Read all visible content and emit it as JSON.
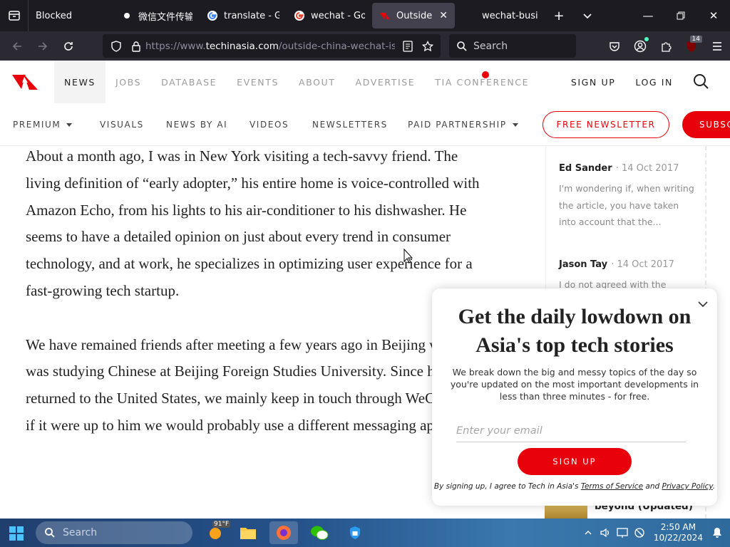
{
  "browser": {
    "tabs": [
      {
        "title": "Blocked",
        "icon": "tab-menu-icon",
        "active": false
      },
      {
        "title": "微信文件传输助手",
        "icon": "wechat-file-icon",
        "active": false
      },
      {
        "title": "translate - Goo",
        "icon": "google-icon",
        "active": false
      },
      {
        "title": "wechat - Goog",
        "icon": "google-icon",
        "active": false
      },
      {
        "title": "Outside of C",
        "icon": "techinasia-icon",
        "active": true
      },
      {
        "title": "wechat-busine",
        "icon": "generic-page-icon",
        "active": false
      }
    ],
    "url_prefix": "https://www.",
    "url_domain": "techinasia.com",
    "url_path": "/outside-china-wechat-is-a-fis",
    "search_placeholder": "Search",
    "extension_badge": "14"
  },
  "site": {
    "brand_color": "#e8000b",
    "nav": [
      "NEWS",
      "JOBS",
      "DATABASE",
      "EVENTS",
      "ABOUT",
      "ADVERTISE",
      "TIA CONFERENCE"
    ],
    "active_nav": "NEWS",
    "sign_up": "SIGN UP",
    "log_in": "LOG IN",
    "subnav": [
      "PREMIUM",
      "VISUALS",
      "NEWS BY AI",
      "VIDEOS",
      "NEWSLETTERS",
      "PAID PARTNERSHIP"
    ],
    "free_newsletter": "FREE NEWSLETTER",
    "subscribe": "SUBSC"
  },
  "article": {
    "paragraphs": [
      "About a month ago, I was in New York visiting a tech-savvy friend. The living definition of “early adopter,” his entire home is voice-controlled with Amazon Echo, from his lights to his air-conditioner to his dishwasher. He seems to have a detailed opinion on just about every trend in consumer technology, and at work, he specializes in optimizing user experience for a fast-growing tech startup.",
      "We have remained friends after meeting a few years ago in Beijing when he was studying Chinese at Beijing Foreign Studies University. Since he returned to the United States, we mainly keep in touch through WeChat, but if it were up to him we would probably use a different messaging app."
    ]
  },
  "comments": [
    {
      "author": "Ed Sander",
      "date": "14 Oct 2017",
      "text": "I'm wondering if, when writing the article, you have taken into account that the..."
    },
    {
      "author": "Jason Tay",
      "date": "14 Oct 2017",
      "text": "I do not agreed with the writer."
    }
  ],
  "popup": {
    "title": "Get the daily lowdown on Asia's top tech stories",
    "description": "We break down the big and messy topics of the day so you're updated on the most important developments in less than three minutes - for free.",
    "email_placeholder": "Enter your email",
    "button": "SIGN UP",
    "legal_prefix": "By signing up, I agree to Tech in Asia's ",
    "terms": "Terms of Service",
    "legal_and": " and ",
    "privacy": "Privacy Policy",
    "legal_suffix": "."
  },
  "related": {
    "title": "beyond (Updated)"
  },
  "taskbar": {
    "search_placeholder": "Search",
    "weather": "91°F",
    "time": "2:50 AM",
    "date": "10/22/2024"
  }
}
